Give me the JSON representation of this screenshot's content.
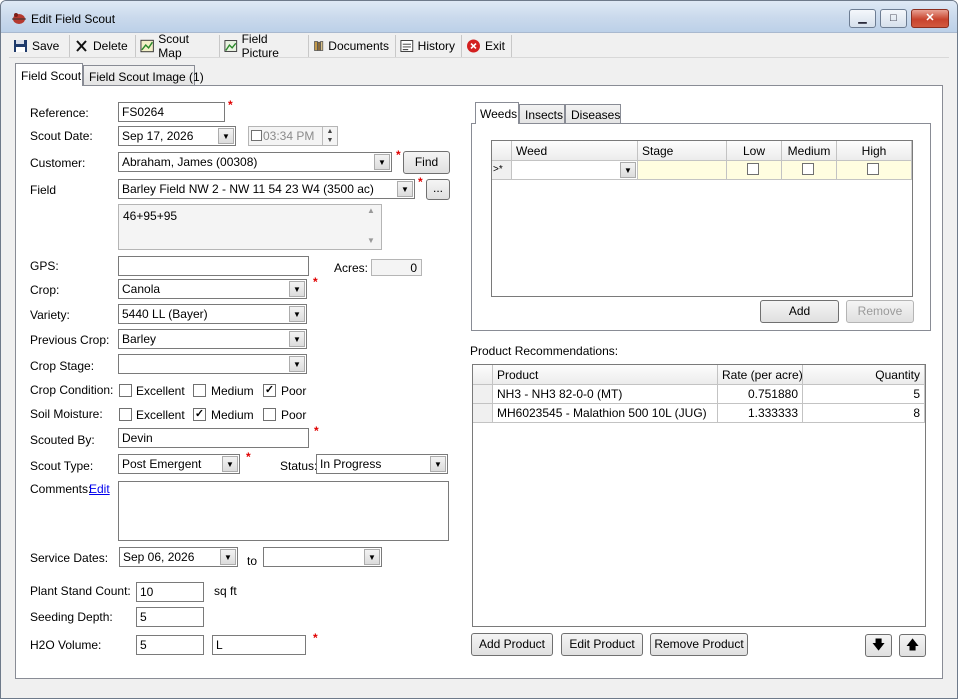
{
  "window": {
    "title": "Edit Field Scout",
    "min": "▁",
    "max": "□",
    "close": "✕"
  },
  "toolbar": {
    "save": "Save",
    "delete": "Delete",
    "scout_map": "Scout Map",
    "field_picture": "Field Picture",
    "documents": "Documents",
    "history": "History",
    "exit": "Exit"
  },
  "tabs": [
    "Field Scout",
    "Field Scout Image (1)"
  ],
  "form": {
    "reference_label": "Reference:",
    "reference": "FS0264",
    "scout_date_label": "Scout Date:",
    "scout_date": "Sep 17, 2026",
    "scout_time": "03:34 PM",
    "customer_label": "Customer:",
    "customer": "Abraham, James (00308)",
    "find": "Find",
    "field_label": "Field",
    "field": "Barley Field NW 2 - NW 11 54 23 W4 (3500 ac)",
    "field_more": "...",
    "field_notes": "46+95+95",
    "gps_label": "GPS:",
    "gps": "",
    "acres_label": "Acres:",
    "acres": "0",
    "crop_label": "Crop:",
    "crop": "Canola",
    "variety_label": "Variety:",
    "variety": "5440 LL (Bayer)",
    "prev_crop_label": "Previous Crop:",
    "prev_crop": "Barley",
    "crop_stage_label": "Crop Stage:",
    "crop_stage": "",
    "crop_condition_label": "Crop Condition:",
    "soil_moisture_label": "Soil Moisture:",
    "opt_excellent": "Excellent",
    "opt_medium": "Medium",
    "opt_poor": "Poor",
    "crop_condition_value": "Poor",
    "soil_moisture_value": "Medium",
    "scouted_by_label": "Scouted By:",
    "scouted_by": "Devin",
    "scout_type_label": "Scout Type:",
    "scout_type": "Post Emergent",
    "status_label": "Status:",
    "status": "In Progress",
    "comments_label": "Comments:",
    "comments_edit": "Edit",
    "comments": "",
    "service_dates_label": "Service Dates:",
    "service_from": "Sep 06, 2026",
    "to_label": "to",
    "service_to": "",
    "plant_stand_label": "Plant Stand Count:",
    "plant_stand": "10",
    "plant_stand_unit": "sq ft",
    "seeding_depth_label": "Seeding Depth:",
    "seeding_depth": "5",
    "h2o_label": "H2O Volume:",
    "h2o": "5",
    "h2o_unit": "L"
  },
  "pest_tabs": [
    "Weeds",
    "Insects",
    "Diseases"
  ],
  "weeds_grid": {
    "columns": [
      "Weed",
      "Stage",
      "Low",
      "Medium",
      "High"
    ],
    "row_marker": ">*"
  },
  "weeds_buttons": {
    "add": "Add",
    "remove": "Remove"
  },
  "products": {
    "title": "Product Recommendations:",
    "columns": [
      "Product",
      "Rate (per acre)",
      "Quantity"
    ],
    "rows": [
      {
        "product": "NH3 - NH3 82-0-0 (MT)",
        "rate": "0.751880",
        "quantity": "5"
      },
      {
        "product": "MH6023545 - Malathion 500 10L (JUG)",
        "rate": "1.333333",
        "quantity": "8"
      }
    ],
    "add": "Add Product",
    "edit": "Edit Product",
    "remove": "Remove Product",
    "down": "🡇",
    "up": "🡅"
  },
  "colors": {
    "required": "#e00000",
    "grid_new_row": "#fffde0",
    "link": "#0000ee"
  }
}
